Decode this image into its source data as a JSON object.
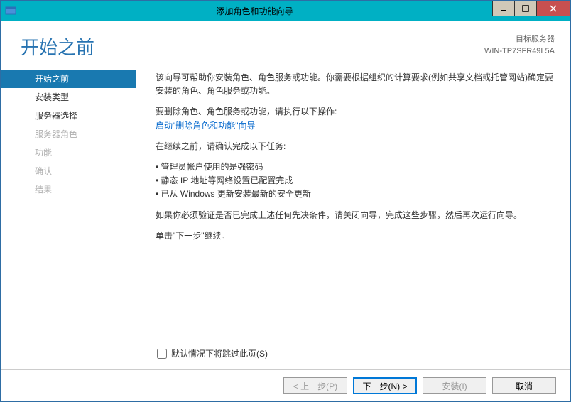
{
  "window": {
    "title": "添加角色和功能向导"
  },
  "header": {
    "title": "开始之前",
    "target_label": "目标服务器",
    "target_value": "WIN-TP7SFR49L5A"
  },
  "sidebar": {
    "items": [
      {
        "label": "开始之前",
        "state": "active"
      },
      {
        "label": "安装类型",
        "state": "enabled"
      },
      {
        "label": "服务器选择",
        "state": "enabled"
      },
      {
        "label": "服务器角色",
        "state": "disabled"
      },
      {
        "label": "功能",
        "state": "disabled"
      },
      {
        "label": "确认",
        "state": "disabled"
      },
      {
        "label": "结果",
        "state": "disabled"
      }
    ]
  },
  "content": {
    "intro": "该向导可帮助你安装角色、角色服务或功能。你需要根据组织的计算要求(例如共享文档或托管网站)确定要安装的角色、角色服务或功能。",
    "remove_label": "要删除角色、角色服务或功能，请执行以下操作:",
    "remove_link": "启动\"删除角色和功能\"向导",
    "pre_tasks_label": "在继续之前，请确认完成以下任务:",
    "tasks": [
      "管理员帐户使用的是强密码",
      "静态 IP 地址等网络设置已配置完成",
      "已从 Windows 更新安装最新的安全更新"
    ],
    "verify_note": "如果你必须验证是否已完成上述任何先决条件，请关闭向导，完成这些步骤，然后再次运行向导。",
    "continue_note": "单击\"下一步\"继续。"
  },
  "checkbox": {
    "label": "默认情况下将跳过此页(S)"
  },
  "footer": {
    "prev": "< 上一步(P)",
    "next": "下一步(N) >",
    "install": "安装(I)",
    "cancel": "取消"
  }
}
